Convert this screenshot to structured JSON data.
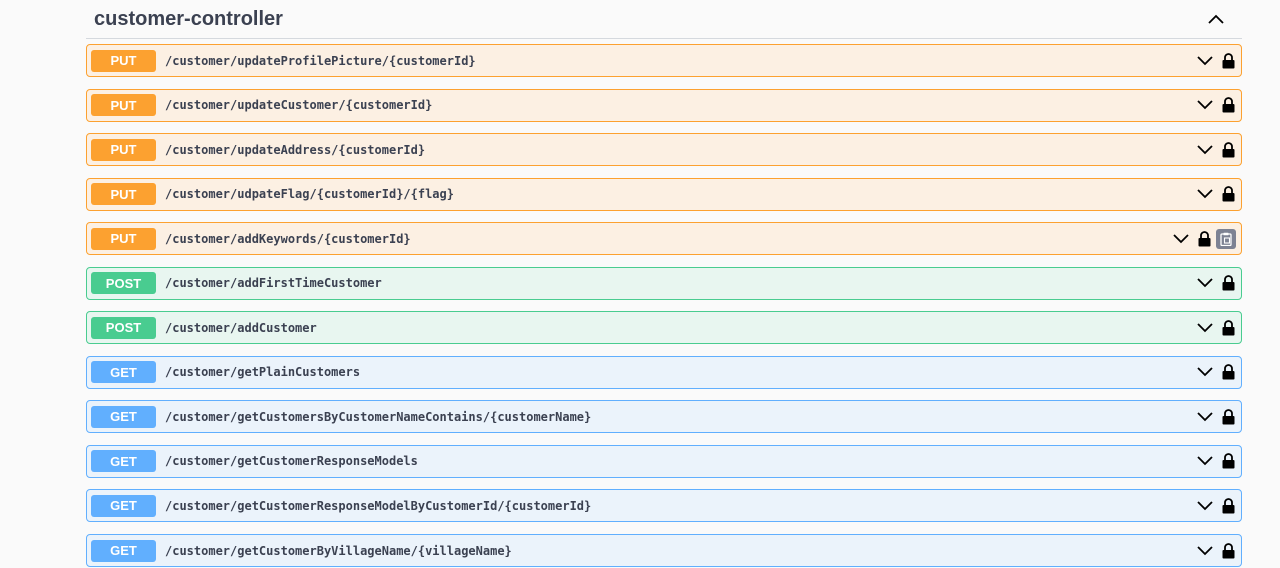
{
  "section": {
    "title": "customer-controller"
  },
  "operations": [
    {
      "method": "PUT",
      "path": "/customer/updateProfilePicture/{customerId}"
    },
    {
      "method": "PUT",
      "path": "/customer/updateCustomer/{customerId}"
    },
    {
      "method": "PUT",
      "path": "/customer/updateAddress/{customerId}"
    },
    {
      "method": "PUT",
      "path": "/customer/udpateFlag/{customerId}/{flag}"
    },
    {
      "method": "PUT",
      "path": "/customer/addKeywords/{customerId}"
    },
    {
      "method": "POST",
      "path": "/customer/addFirstTimeCustomer"
    },
    {
      "method": "POST",
      "path": "/customer/addCustomer"
    },
    {
      "method": "GET",
      "path": "/customer/getPlainCustomers"
    },
    {
      "method": "GET",
      "path": "/customer/getCustomersByCustomerNameContains/{customerName}"
    },
    {
      "method": "GET",
      "path": "/customer/getCustomerResponseModels"
    },
    {
      "method": "GET",
      "path": "/customer/getCustomerResponseModelByCustomerId/{customerId}"
    },
    {
      "method": "GET",
      "path": "/customer/getCustomerByVillageName/{villageName}"
    }
  ],
  "icons": {
    "section_toggle": "chevron-up-icon",
    "expand": "chevron-down-icon",
    "lock": "lock-icon",
    "copy": "copy-to-clipboard-icon"
  },
  "colors": {
    "put": "#fca130",
    "post": "#49cc90",
    "get": "#61affe",
    "text": "#3b4151"
  }
}
